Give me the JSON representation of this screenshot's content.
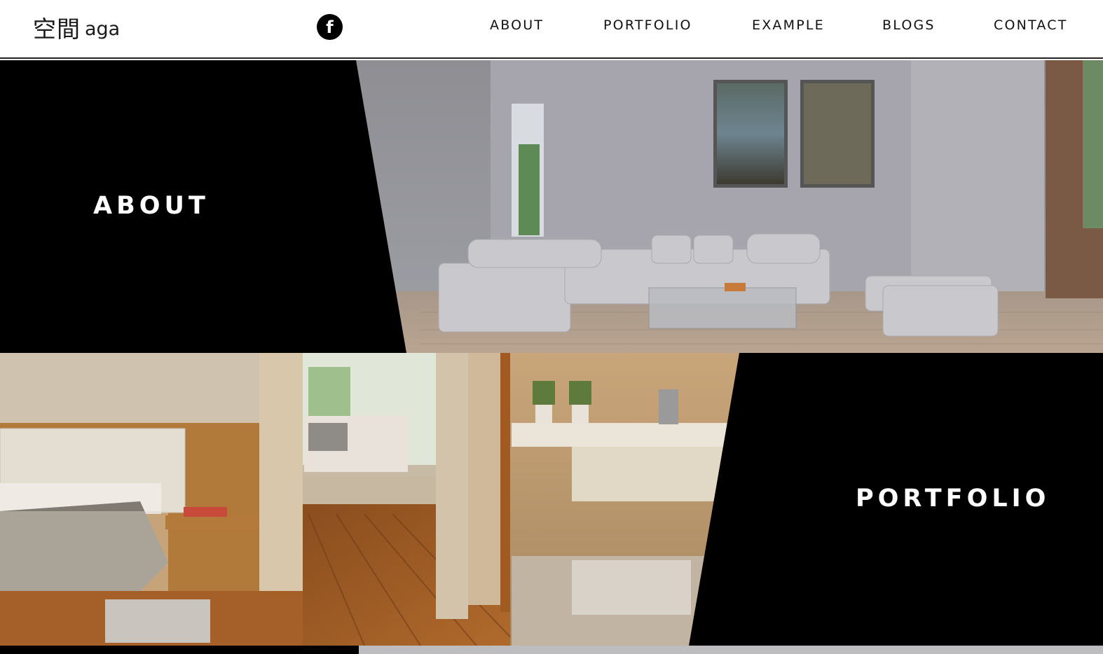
{
  "header": {
    "logo_kanji": "空間",
    "logo_latin": "aga",
    "social_icon": "facebook-icon",
    "social_glyph": "f",
    "nav": [
      "ABOUT",
      "PORTFOLIO",
      "EXAMPLE",
      "BLOGS",
      "CONTACT"
    ]
  },
  "sections": {
    "about": {
      "label": "ABOUT"
    },
    "portfolio": {
      "label": "PORTFOLIO"
    }
  },
  "colors": {
    "panel_black": "#000000",
    "header_bg": "#ffffff",
    "text_dark": "#111111",
    "text_light": "#ffffff"
  }
}
